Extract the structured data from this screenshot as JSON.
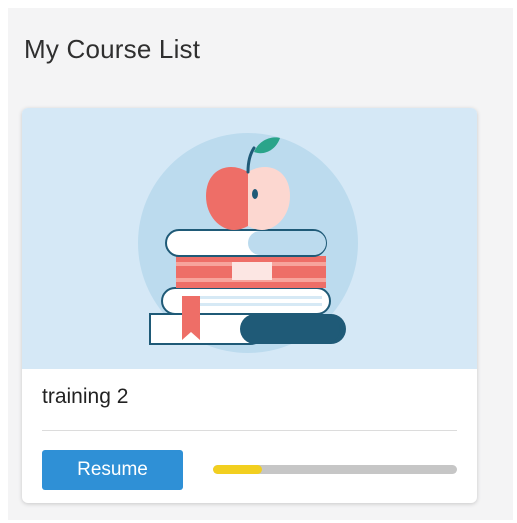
{
  "panel": {
    "title": "My Course List"
  },
  "course": {
    "name": "training 2",
    "resume_label": "Resume",
    "progress": 0.2,
    "thumbnail_icon": "apple-on-books-illustration"
  },
  "colors": {
    "primary_button": "#2f90d6",
    "progress_fill": "#f2cf1f",
    "progress_track": "#c6c6c6",
    "thumbnail_bg": "#d5e8f6"
  }
}
